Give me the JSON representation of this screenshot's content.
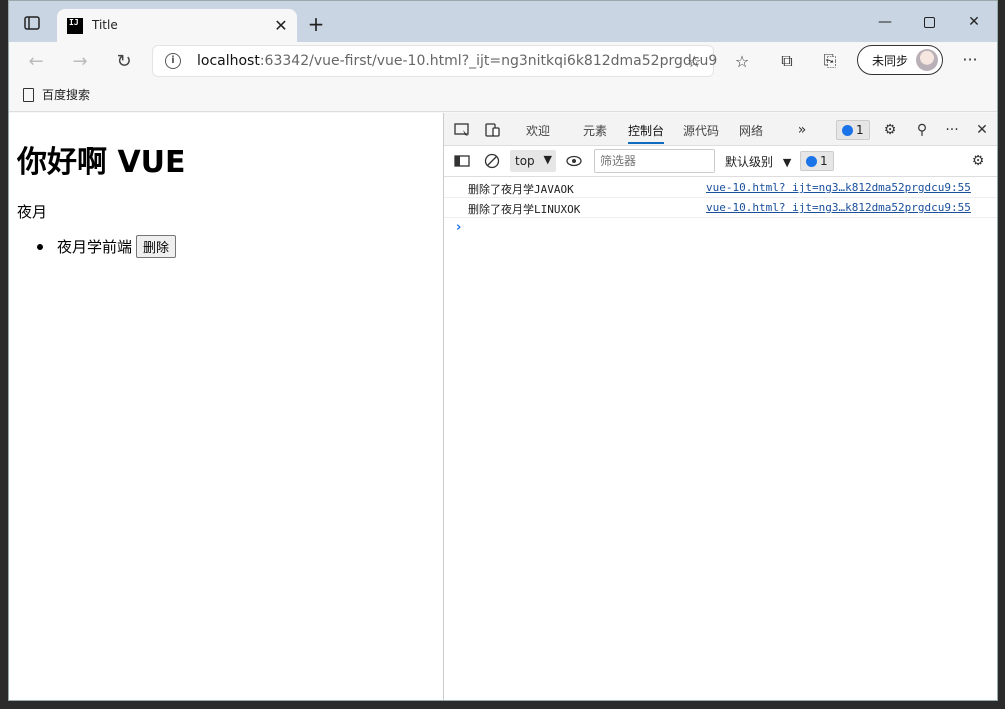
{
  "browser": {
    "tab": {
      "title": "Title",
      "favicon_text": "IJ"
    },
    "address_bar": {
      "host": "localhost",
      "rest": ":63342/vue-first/vue-10.html?_ijt=ng3nitkqi6k812dma52prgdcu9"
    },
    "sync_label": "未同步",
    "favorites": [
      {
        "label": "百度搜索"
      }
    ]
  },
  "page": {
    "heading": "你好啊 VUE",
    "name": "夜月",
    "items": [
      {
        "label": "夜月学前端",
        "button": "删除"
      }
    ]
  },
  "devtools": {
    "tabs": [
      "欢迎",
      "元素",
      "控制台",
      "源代码",
      "网络"
    ],
    "active_tab": "控制台",
    "issue_count": "1",
    "context": "top",
    "filter_placeholder": "筛选器",
    "level_label": "默认级别",
    "message_count": "1",
    "console": [
      {
        "message": "删除了夜月学JAVAOK",
        "source": "vue-10.html? ijt=ng3…k812dma52prgdcu9:55"
      },
      {
        "message": "删除了夜月学LINUXOK",
        "source": "vue-10.html? ijt=ng3…k812dma52prgdcu9:55"
      }
    ],
    "prompt": "›"
  },
  "colors": {
    "accent": "#0f6cbd",
    "titlebar": "#c9d5e2"
  }
}
